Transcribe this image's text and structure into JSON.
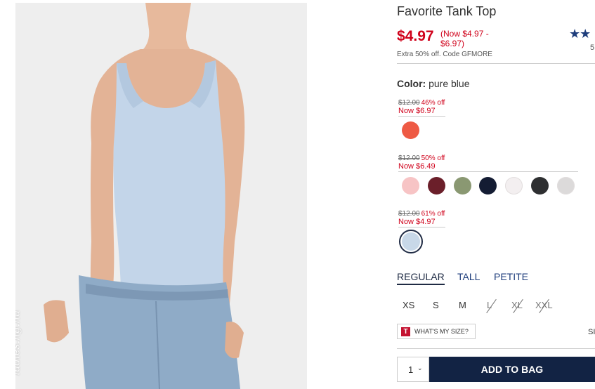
{
  "product": {
    "title": "Favorite Tank Top",
    "price": "$4.97",
    "price_range": "(Now $4.97 - $6.97)",
    "promo": "Extra 50% off. Code GFMORE",
    "rating_stars": "★★",
    "reviews_count": "5"
  },
  "color": {
    "label": "Color:",
    "value": "pure blue"
  },
  "price_tiers": [
    {
      "original": "$12.00",
      "discount": "46% off",
      "now": "Now $6.97",
      "swatches": [
        {
          "name": "coral",
          "color": "#ee5a44"
        }
      ]
    },
    {
      "original": "$12.00",
      "discount": "50% off",
      "now": "Now $6.49",
      "swatches": [
        {
          "name": "light pink",
          "color": "#f7c4c5"
        },
        {
          "name": "burgundy",
          "color": "#6b1f2a"
        },
        {
          "name": "olive",
          "color": "#8a9872"
        },
        {
          "name": "navy",
          "color": "#141c33"
        },
        {
          "name": "white",
          "color": "#f3eff0"
        },
        {
          "name": "charcoal",
          "color": "#2e2f31"
        },
        {
          "name": "heather grey",
          "color": "#dcdada"
        }
      ]
    },
    {
      "original": "$12.00",
      "discount": "61% off",
      "now": "Now $4.97",
      "swatches": [
        {
          "name": "pure blue",
          "color": "#c8d8e8",
          "selected": true
        }
      ]
    }
  ],
  "fits": [
    "REGULAR",
    "TALL",
    "PETITE"
  ],
  "sizes": [
    {
      "label": "XS",
      "available": true
    },
    {
      "label": "S",
      "available": true
    },
    {
      "label": "M",
      "available": true
    },
    {
      "label": "L",
      "available": false
    },
    {
      "label": "XL",
      "available": false
    },
    {
      "label": "XXL",
      "available": false
    }
  ],
  "whats_my_size": {
    "badge": "T",
    "label": "WHAT'S MY SIZE?"
  },
  "size_guide_label": "SI",
  "quantity": {
    "value": "1",
    "chevron": "⌄"
  },
  "add_to_bag": "ADD TO BAG",
  "watermark": "ladies.ng.nu",
  "colors": {
    "sale_red": "#d0021b",
    "navy": "#122344",
    "image_bg": "#eeeeee"
  }
}
